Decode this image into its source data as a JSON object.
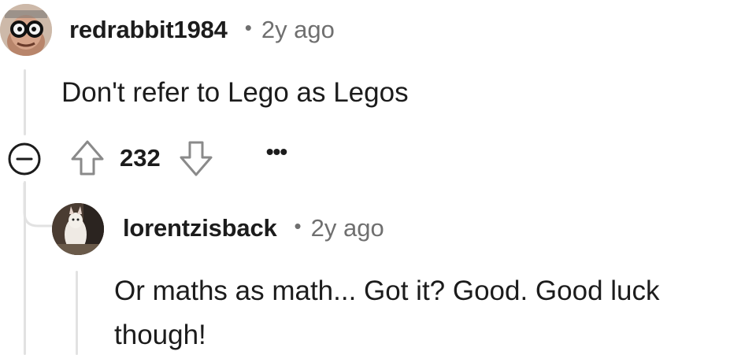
{
  "comments": [
    {
      "username": "redrabbit1984",
      "separator": "•",
      "time": "2y ago",
      "body": "Don't refer to Lego as Legos",
      "votes": "232",
      "more_label": "•••",
      "icons": {
        "collapse": "collapse-minus-icon",
        "upvote": "upvote-arrow-icon",
        "downvote": "downvote-arrow-icon"
      }
    },
    {
      "username": "lorentzisback",
      "separator": "•",
      "time": "2y ago",
      "body_line1": "Or maths as math... Got it? Good. Good luck",
      "body_line2": "though!"
    }
  ],
  "colors": {
    "text": "#1c1c1c",
    "meta": "#6f6f6f",
    "thread_line": "#e2e2e2"
  }
}
